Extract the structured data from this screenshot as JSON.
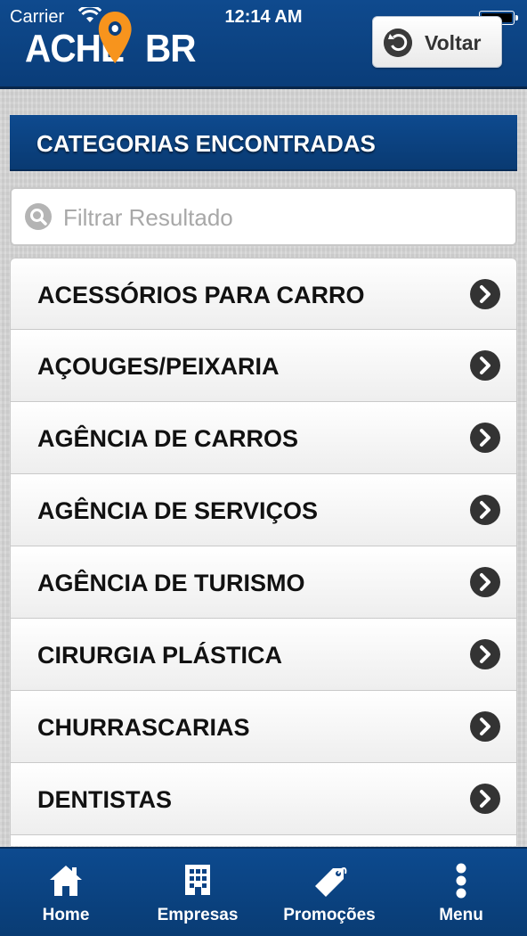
{
  "status_bar": {
    "carrier": "Carrier",
    "time": "12:14 AM"
  },
  "header": {
    "logo_text": "ACHEI BR",
    "back_label": "Voltar"
  },
  "section_title": "CATEGORIAS ENCONTRADAS",
  "search": {
    "placeholder": "Filtrar Resultado",
    "value": ""
  },
  "categories": [
    {
      "label": "ACESSÓRIOS PARA CARRO"
    },
    {
      "label": "AÇOUGES/PEIXARIA"
    },
    {
      "label": "AGÊNCIA DE CARROS"
    },
    {
      "label": "AGÊNCIA DE SERVIÇOS"
    },
    {
      "label": "AGÊNCIA DE TURISMO"
    },
    {
      "label": "CIRURGIA PLÁSTICA"
    },
    {
      "label": "CHURRASCARIAS"
    },
    {
      "label": "DENTISTAS"
    },
    {
      "label": ""
    }
  ],
  "tabbar": [
    {
      "label": "Home",
      "icon": "home-icon"
    },
    {
      "label": "Empresas",
      "icon": "building-icon"
    },
    {
      "label": "Promoções",
      "icon": "tag-icon"
    },
    {
      "label": "Menu",
      "icon": "more-vertical-icon"
    }
  ],
  "colors": {
    "brand_blue": "#0b4284",
    "logo_pin": "#f7941d",
    "chevron_dark": "#333333"
  }
}
